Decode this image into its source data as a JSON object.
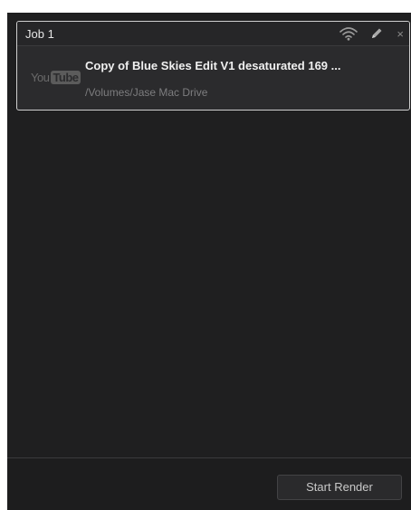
{
  "job": {
    "title": "Job 1",
    "name": "Copy of Blue Skies Edit V1 desaturated 169 ...",
    "path": "/Volumes/Jase Mac Drive",
    "logo_you": "You",
    "logo_tube": "Tube",
    "icons": [
      "wifi-icon",
      "pencil-icon",
      "close-icon"
    ],
    "close_glyph": "×"
  },
  "footer": {
    "start_render_label": "Start Render"
  }
}
